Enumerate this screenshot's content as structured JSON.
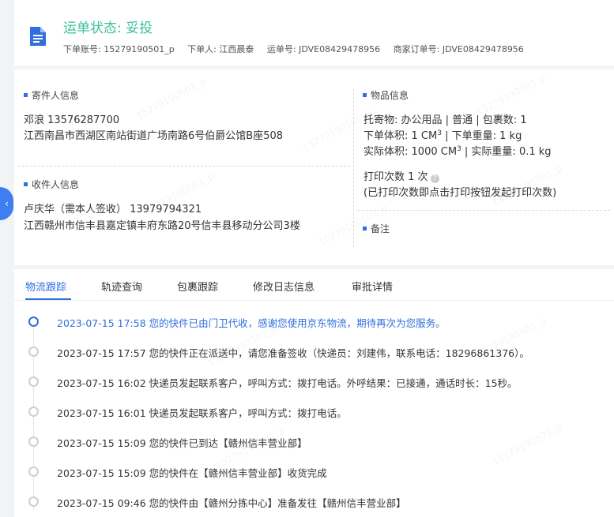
{
  "header": {
    "status_title": "运单状态: 妥投",
    "order_account_label": "下单账号:",
    "order_account": "15279190501_p",
    "orderer_label": "下单人:",
    "orderer": "江西晨泰",
    "waybill_label": "运单号:",
    "waybill": "JDVE08429478956",
    "merchant_order_label": "商家订单号:",
    "merchant_order": "JDVE08429478956"
  },
  "sender": {
    "title": "寄件人信息",
    "name_phone": "邓浪   13576287700",
    "address": "江西南昌市西湖区南站街道广场南路6号伯爵公馆B座508"
  },
  "receiver": {
    "title": "收件人信息",
    "name_phone": "卢庆华（需本人签收）  13979794321",
    "address": "江西赣州市信丰县嘉定镇丰府东路20号信丰县移动分公司3楼"
  },
  "goods": {
    "title": "物品信息",
    "line1": "托寄物:  办公用品 | 普通 | 包裹数:  1",
    "order_volume_label": "下单体积:",
    "order_volume_value": "1 CM",
    "order_weight": "| 下单重量:  1 kg",
    "actual_volume_label": "实际体积:",
    "actual_volume_value": "1000 CM",
    "actual_weight": "| 实际重量:  0.1 kg",
    "superscript": "3",
    "print_label": "打印次数",
    "print_count": "1 次",
    "help_glyph": "?",
    "print_note": "(已打印次数即点击打印按钮发起打印次数)",
    "remark_title": "备注"
  },
  "collapse_tab": {
    "glyph": "‹"
  },
  "watermark": "15279190501_p",
  "tabs": [
    "物流跟踪",
    "轨迹查询",
    "包裹跟踪",
    "修改日志信息",
    "审批详情"
  ],
  "timeline": [
    "2023-07-15 17:58 您的快件已由门卫代收，感谢您使用京东物流，期待再次为您服务。",
    "2023-07-15 17:57 您的快件正在派送中，请您准备签收（快递员：刘建伟，联系电话：18296861376）。",
    "2023-07-15 16:02 快递员发起联系客户，呼叫方式：拨打电话。外呼结果：已接通，通话时长：15秒。",
    "2023-07-15 16:01 快递员发起联系客户，呼叫方式：拨打电话。",
    "2023-07-15 15:09 您的快件已到达【赣州信丰营业部】",
    "2023-07-15 15:09 您的快件在【赣州信丰营业部】收货完成",
    "2023-07-15 09:46 您的快件由【赣州分拣中心】准备发往【赣州信丰营业部】"
  ],
  "colors": {
    "status_green": "#3bbf9a",
    "accent_blue": "#2f6fde"
  }
}
